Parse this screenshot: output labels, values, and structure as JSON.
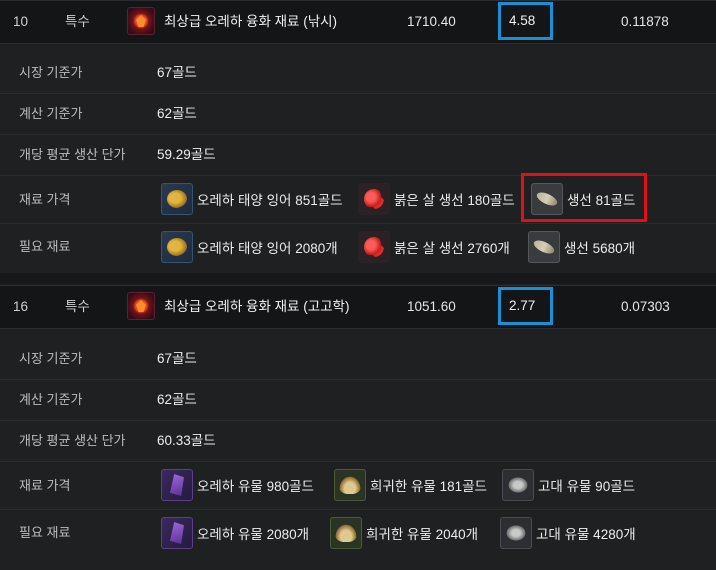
{
  "items": [
    {
      "no": "10",
      "type": "특수",
      "name": "최상급 오레하 융화 재료 (낚시)",
      "value1": "1710.40",
      "value2": "4.58",
      "value3": "0.11878",
      "rows": {
        "market_label": "시장 기준가",
        "market_value": "67골드",
        "calc_label": "계산 기준가",
        "calc_value": "62골드",
        "avg_label": "개당 평균 생산 단가",
        "avg_value": "59.29골드",
        "price_label": "재료 가격",
        "need_label": "필요 재료"
      },
      "prices": [
        "오레하 태양 잉어 851골드",
        "붉은 살 생선 180골드",
        "생선 81골드"
      ],
      "needs": [
        "오레하 태양 잉어 2080개",
        "붉은 살 생선 2760개",
        "생선 5680개"
      ]
    },
    {
      "no": "16",
      "type": "특수",
      "name": "최상급 오레하 융화 재료 (고고학)",
      "value1": "1051.60",
      "value2": "2.77",
      "value3": "0.07303",
      "rows": {
        "market_label": "시장 기준가",
        "market_value": "67골드",
        "calc_label": "계산 기준가",
        "calc_value": "62골드",
        "avg_label": "개당 평균 생산 단가",
        "avg_value": "60.33골드",
        "price_label": "재료 가격",
        "need_label": "필요 재료"
      },
      "prices": [
        "오레하 유물 980골드",
        "희귀한 유물 181골드",
        "고대 유물 90골드"
      ],
      "needs": [
        "오레하 유물 2080개",
        "희귀한 유물 2040개",
        "고대 유물 4280개"
      ]
    }
  ],
  "icons": {
    "item": "fusion-material-icon",
    "fishing": [
      "sun-carp-icon",
      "red-flesh-fish-icon",
      "fish-icon"
    ],
    "archaeology": [
      "oreha-relic-icon",
      "rare-relic-icon",
      "ancient-relic-icon"
    ]
  },
  "colors": {
    "highlight_blue": "#1b8fd6",
    "highlight_red": "#e0101a"
  }
}
